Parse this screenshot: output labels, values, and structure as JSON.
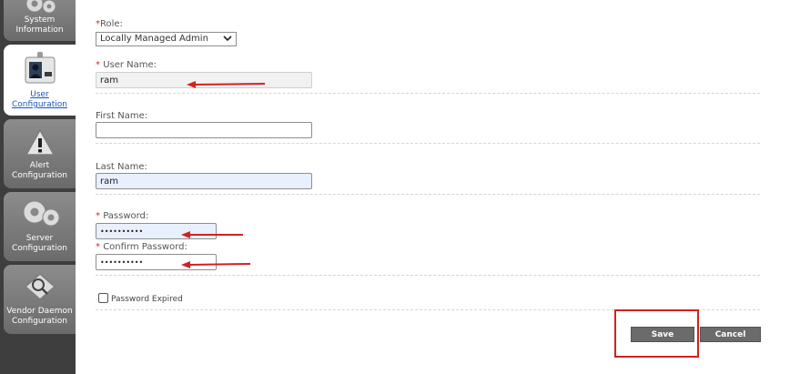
{
  "sidebar": {
    "items": [
      {
        "label1": "System",
        "label2": "Information",
        "icon": "gears-icon"
      },
      {
        "label1": "User",
        "label2": "Configuration",
        "icon": "user-id-card-icon",
        "active": true
      },
      {
        "label1": "Alert",
        "label2": "Configuration",
        "icon": "alert-warning-icon"
      },
      {
        "label1": "Server",
        "label2": "Configuration",
        "icon": "gears-icon"
      },
      {
        "label1": "Vendor Daemon",
        "label2": "Configuration",
        "icon": "magnifier-card-icon"
      }
    ]
  },
  "form": {
    "role_label": "Role:",
    "role_value": "Locally Managed Admin",
    "username_label": "User Name:",
    "username_value": "ram",
    "firstname_label": "First Name:",
    "firstname_value": "",
    "lastname_label": "Last Name:",
    "lastname_value": "ram",
    "password_label": "Password:",
    "password_value": "••••••••••",
    "confirm_label": "Confirm Password:",
    "confirm_value": "••••••••••",
    "expired_label": "Password Expired",
    "required_mark": "*"
  },
  "buttons": {
    "save": "Save",
    "cancel": "Cancel"
  },
  "colors": {
    "annotation": "#d32020",
    "sidebar": "#3e3e3e",
    "button": "#6b6b6b"
  }
}
